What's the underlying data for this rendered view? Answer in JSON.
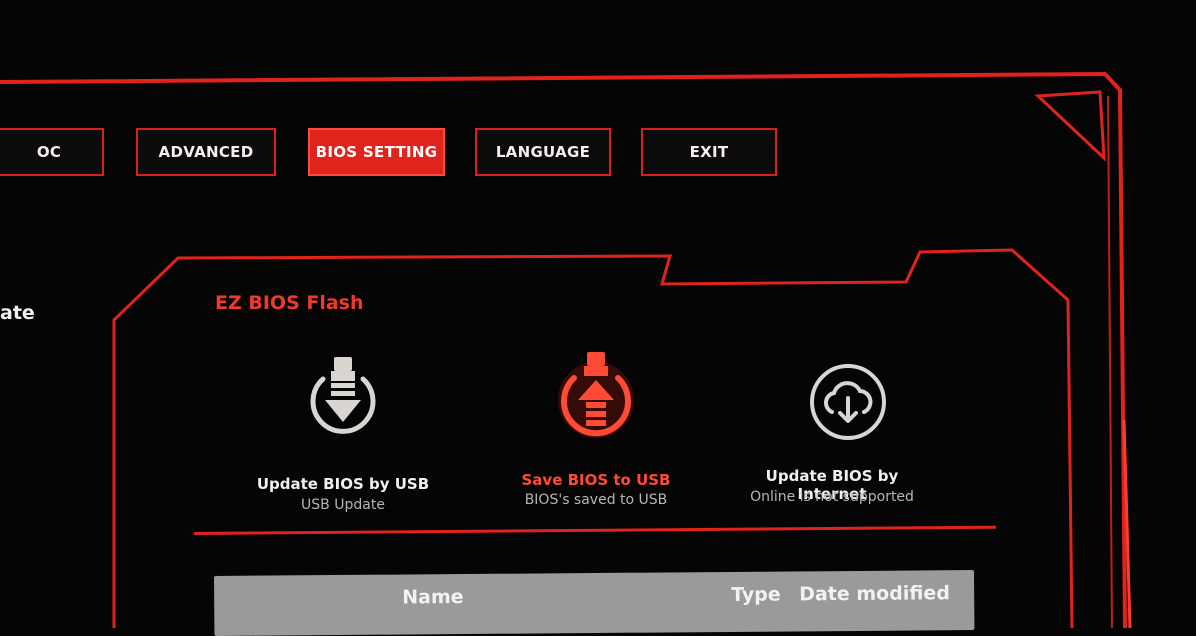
{
  "tabs": [
    {
      "label": "OC",
      "active": false
    },
    {
      "label": "ADVANCED",
      "active": false
    },
    {
      "label": "BIOS SETTING",
      "active": true
    },
    {
      "label": "LANGUAGE",
      "active": false
    },
    {
      "label": "EXIT",
      "active": false
    }
  ],
  "left_menu": {
    "partial_label": "ate"
  },
  "section": {
    "title": "EZ BIOS Flash"
  },
  "options": [
    {
      "title": "Update BIOS by USB",
      "subtitle": "USB Update",
      "icon": "usb-update-icon"
    },
    {
      "title": "Save BIOS to USB",
      "subtitle": "BIOS's saved to USB",
      "icon": "usb-save-icon",
      "selected": true
    },
    {
      "title": "Update BIOS by Internet",
      "subtitle": "Online is not supported",
      "icon": "cloud-download-icon"
    }
  ],
  "file_table": {
    "columns": [
      "Name",
      "Type",
      "Date modified"
    ]
  },
  "colors": {
    "accent": "#e0241d",
    "background": "#060506",
    "text": "#f2efec",
    "subtext": "#b9b4af"
  }
}
